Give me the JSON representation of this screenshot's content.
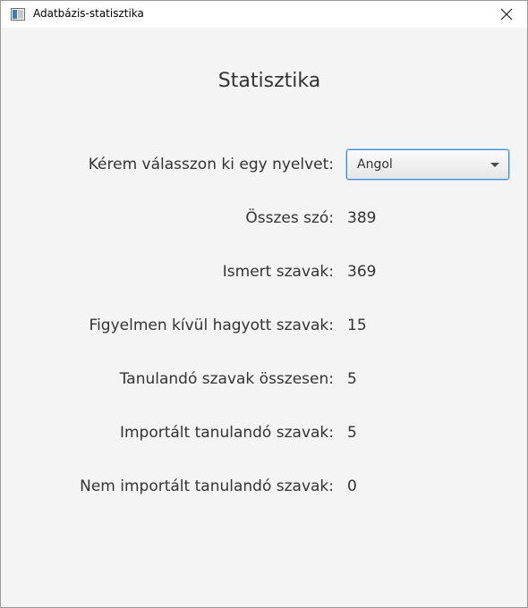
{
  "window": {
    "title": "Adatbázis-statisztika"
  },
  "main": {
    "heading": "Statisztika",
    "language_label": "Kérem válasszon ki egy nyelvet:",
    "language_selected": "Angol",
    "stats": [
      {
        "label": "Összes szó:",
        "value": "389"
      },
      {
        "label": "Ismert szavak:",
        "value": "369"
      },
      {
        "label": "Figyelmen kívül hagyott szavak:",
        "value": "15"
      },
      {
        "label": "Tanulandó szavak összesen:",
        "value": "5"
      },
      {
        "label": "Importált tanulandó szavak:",
        "value": "5"
      },
      {
        "label": "Nem importált tanulandó szavak:",
        "value": "0"
      }
    ]
  },
  "icons": {
    "app": "app-window-icon",
    "close": "close-icon",
    "dropdown": "chevron-down-icon"
  }
}
